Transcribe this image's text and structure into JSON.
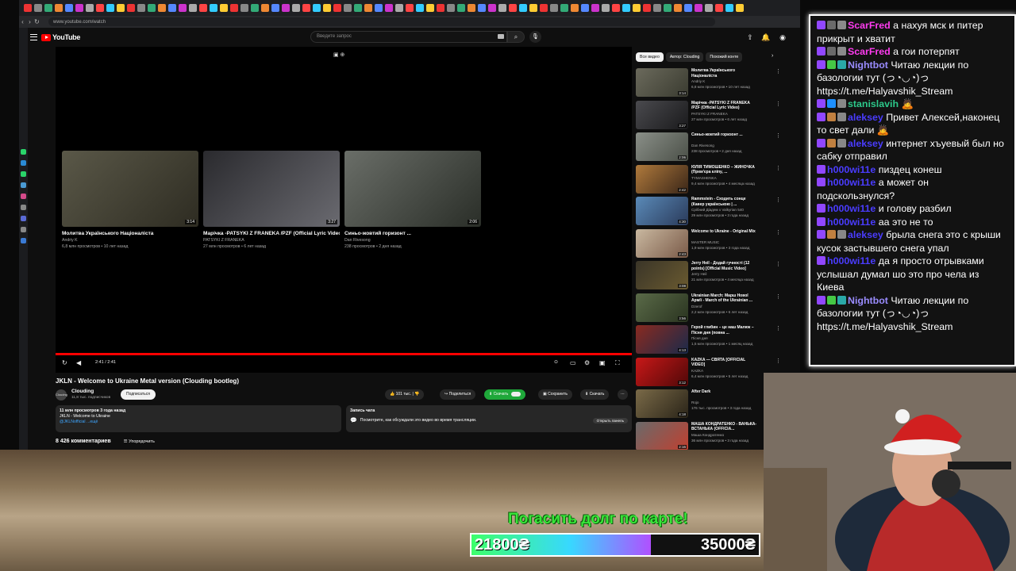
{
  "browser": {
    "url": "www.youtube.com/watch"
  },
  "youtube": {
    "search_placeholder": "Введите запрос",
    "end_screen": [
      {
        "title": "Молитва Українського Націоналіста",
        "channel": "Andriy K",
        "meta": "6,8 млн просмотров • 10 лет назад",
        "duration": "3:14"
      },
      {
        "title": "Марічка -PATSYKI Z FRANEKA /PZF (Official Lyric Video)",
        "channel": "PATSYKI Z FRANEKA",
        "meta": "27 млн просмотров • 6 лет назад",
        "duration": "3:27"
      },
      {
        "title": "Синьо-жовтий горизонт ...",
        "channel": "Dan Rivesong",
        "meta": "238 просмотров • 2 дня назад",
        "duration": "2:06"
      }
    ],
    "player": {
      "time": "2:41 / 2:41",
      "progress": 1.0
    },
    "video_title": "JKLN - Welcome to Ukraine Metal version (Clouding bootleg)",
    "channel": {
      "name": "Clouding",
      "subs": "11,8 тыс. подписчиков",
      "avatar_text": "Cloudng",
      "subscribe": "Подписаться"
    },
    "actions": {
      "likes": "101 тыс.",
      "share": "Поделиться",
      "download_green": "Скачать",
      "save": "Сохранить",
      "download": "Скачать"
    },
    "description": {
      "line1": "11 млн просмотров  3 года назад",
      "line2": "JKLN - Welcome to Ukraine",
      "line3": "@JKLNofficial  ...ещё"
    },
    "chat_replay": {
      "title": "Запись чата",
      "text": "Посмотрите, как обсуждали это видео во время трансляции.",
      "button": "Открыть панель"
    },
    "comments": {
      "count": "8 426 комментариев",
      "sort": "Упорядочить"
    },
    "chips": [
      "Все видео",
      "Автор: Clouding",
      "Похожий конте"
    ],
    "related": [
      {
        "title": "Молитва Українського Націоналіста",
        "channel": "Andriy K",
        "meta": "6,8 млн просмотров • 10 лет назад",
        "duration": "3:14",
        "c1": "#6b6a5c",
        "c2": "#3a3b30"
      },
      {
        "title": "Марічка -PATSYKI Z FRANEKA /PZF (Official Lyric Video)",
        "channel": "PATSYKI Z FRANEKA",
        "meta": "27 млн просмотров • 6 лет назад",
        "duration": "3:27",
        "c1": "#4a4a4e",
        "c2": "#1a1a1c"
      },
      {
        "title": "Синьо-жовтий горизонт ...",
        "channel": "Dan Rivesong",
        "meta": "238 просмотров • 2 дня назад",
        "duration": "2:06",
        "c1": "#8a8f88",
        "c2": "#4b5048"
      },
      {
        "title": "ЮЛІЯ ТИМОШЕНКО – ЖИНОЧКА (Прем'єра кліпу, ...",
        "channel": "TYMASHENKA",
        "meta": "9,4 млн просмотров • 4 месяца назад",
        "duration": "2:42",
        "c1": "#b07a3c",
        "c2": "#3a2618"
      },
      {
        "title": "Rammstein - Сходить сонце (Кавер українською | ...",
        "channel": "Срібний Діадем x Valkyrian 540",
        "meta": "29 млн просмотров • 3 года назад",
        "duration": "4:30",
        "c1": "#5a8ab8",
        "c2": "#2a3a5a"
      },
      {
        "title": "Welcome to Ukraine - Original Mix",
        "channel": "MASTER MUSIC",
        "meta": "1,9 млн просмотров • 3 года назад",
        "duration": "2:43",
        "c1": "#c9b8a0",
        "c2": "#7a5a48"
      },
      {
        "title": "Jerry Heil - Додай гучності (12 points) [Official Music Video]",
        "channel": "Jerry Heil",
        "meta": "21 млн просмотров • 4 месяца назад",
        "duration": "3:08",
        "c1": "#3a3528",
        "c2": "#6a5a30"
      },
      {
        "title": "Ukrainian March: Марш Нової Армії - March of the Ukrainian ...",
        "channel": "Dzerof",
        "meta": "2,2 млн просмотров • 6 лет назад",
        "duration": "3:56",
        "c1": "#5a6a48",
        "c2": "#2a3420"
      },
      {
        "title": "Герой глибин – це наш Малюк – Пісня дня (повна ...",
        "channel": "Пісня дня",
        "meta": "1,5 млн просмотров • 1 месяц назад",
        "duration": "4:13",
        "c1": "#8a2a20",
        "c2": "#1a2a4a"
      },
      {
        "title": "KAZKA — СВЯТА [OFFICIAL VIDEO]",
        "channel": "KAZKA",
        "meta": "6,4 млн просмотров • 5 лет назад",
        "duration": "3:12",
        "c1": "#c81818",
        "c2": "#500808"
      },
      {
        "title": "After Dark",
        "channel": "Rojo",
        "meta": "176 тыс. просмотров • 3 года назад",
        "duration": "4:18",
        "c1": "#7a6a48",
        "c2": "#2a2418"
      },
      {
        "title": "МАША КОНДРАТЕНКО - ВАНЬКА-ВСТАНЬКА (OFFICIA...",
        "channel": "Маша Кондратенко",
        "meta": "36 млн просмотров • 3 года назад",
        "duration": "2:16",
        "c1": "#6a6a6a",
        "c2": "#c04030"
      }
    ]
  },
  "chat": [
    {
      "user": "ScarFred",
      "color": "#ff3cf0",
      "badges": [
        "#9147ff",
        "#6a6a6a",
        "#8a8a8a"
      ],
      "text": " а нахуя мск и питер прикрыт и хватит"
    },
    {
      "user": "ScarFred",
      "color": "#ff3cf0",
      "badges": [
        "#9147ff",
        "#6a6a6a",
        "#8a8a8a"
      ],
      "text": " а гои потерпят"
    },
    {
      "user": "Nightbot",
      "color": "#9a8cff",
      "badges": [
        "#9147ff",
        "#45c845",
        "#2aa8a8"
      ],
      "text": " Читаю лекции по базологии тут (っ◔◡◔)っ https://t.me/Halyavshik_Stream"
    },
    {
      "user": "stanislavih",
      "color": "#2cc88a",
      "badges": [
        "#9147ff",
        "#1e90ff",
        "#888888"
      ],
      "text": " 🙇"
    },
    {
      "user": "aleksey",
      "color": "#4a3cff",
      "badges": [
        "#9147ff",
        "#c08040",
        "#888888"
      ],
      "text": " Привет Алексей,наконец то свет дали 🙇"
    },
    {
      "user": "aleksey",
      "color": "#4a3cff",
      "badges": [
        "#9147ff",
        "#c08040",
        "#888888"
      ],
      "text": " интернет хъуевый был но сабку отправил"
    },
    {
      "user": "h000wi11e",
      "color": "#4a3cff",
      "badges": [
        "#9147ff"
      ],
      "text": " пиздец конеш"
    },
    {
      "user": "h000wi11e",
      "color": "#4a3cff",
      "badges": [
        "#9147ff"
      ],
      "text": " а может он подскользнулся?"
    },
    {
      "user": "h000wi11e",
      "color": "#4a3cff",
      "badges": [
        "#9147ff"
      ],
      "text": " и голову разбил"
    },
    {
      "user": "h000wi11e",
      "color": "#4a3cff",
      "badges": [
        "#9147ff"
      ],
      "text": " аа это не то"
    },
    {
      "user": "aleksey",
      "color": "#4a3cff",
      "badges": [
        "#9147ff",
        "#c08040",
        "#888888"
      ],
      "text": " брыла снега это с крыши кусок застывшего снега упал"
    },
    {
      "user": "h000wi11e",
      "color": "#4a3cff",
      "badges": [
        "#9147ff"
      ],
      "text": " да я просто отрывками услышал думал шо это про чела из Киева"
    },
    {
      "user": "Nightbot",
      "color": "#9a8cff",
      "badges": [
        "#9147ff",
        "#45c845",
        "#2aa8a8"
      ],
      "text": " Читаю лекции по базологии тут (っ◔◡◔)っ https://t.me/Halyavshik_Stream"
    }
  ],
  "donation": {
    "title": "Погасить долг по карте!",
    "current": "21800₴",
    "goal": "35000₴",
    "progress": 0.623
  }
}
